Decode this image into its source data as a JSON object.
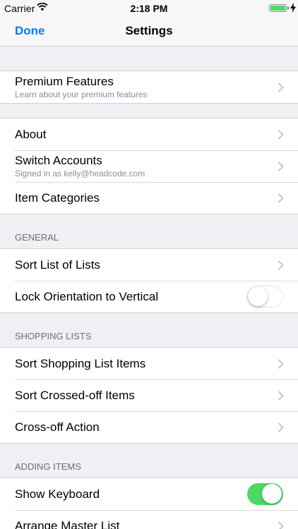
{
  "status_bar": {
    "carrier": "Carrier",
    "time": "2:18 PM"
  },
  "nav": {
    "done_label": "Done",
    "title": "Settings"
  },
  "premium": {
    "title": "Premium Features",
    "subtitle": "Learn about your premium features"
  },
  "account": {
    "about": "About",
    "switch_title": "Switch Accounts",
    "switch_subtitle": "Signed in as kelly@headcode.com",
    "categories": "Item Categories"
  },
  "general": {
    "header": "GENERAL",
    "sort_lists": "Sort List of Lists",
    "lock_orientation": "Lock Orientation to Vertical",
    "lock_orientation_on": false
  },
  "shopping": {
    "header": "SHOPPING LISTS",
    "sort_items": "Sort Shopping List Items",
    "sort_crossed": "Sort Crossed-off Items",
    "crossoff_action": "Cross-off Action"
  },
  "adding": {
    "header": "ADDING ITEMS",
    "show_keyboard": "Show Keyboard",
    "show_keyboard_on": true,
    "arrange_master": "Arrange Master List"
  },
  "colors": {
    "accent": "#0A7AFF",
    "toggle_on": "#4CD964",
    "background": "#EFEFF4"
  }
}
